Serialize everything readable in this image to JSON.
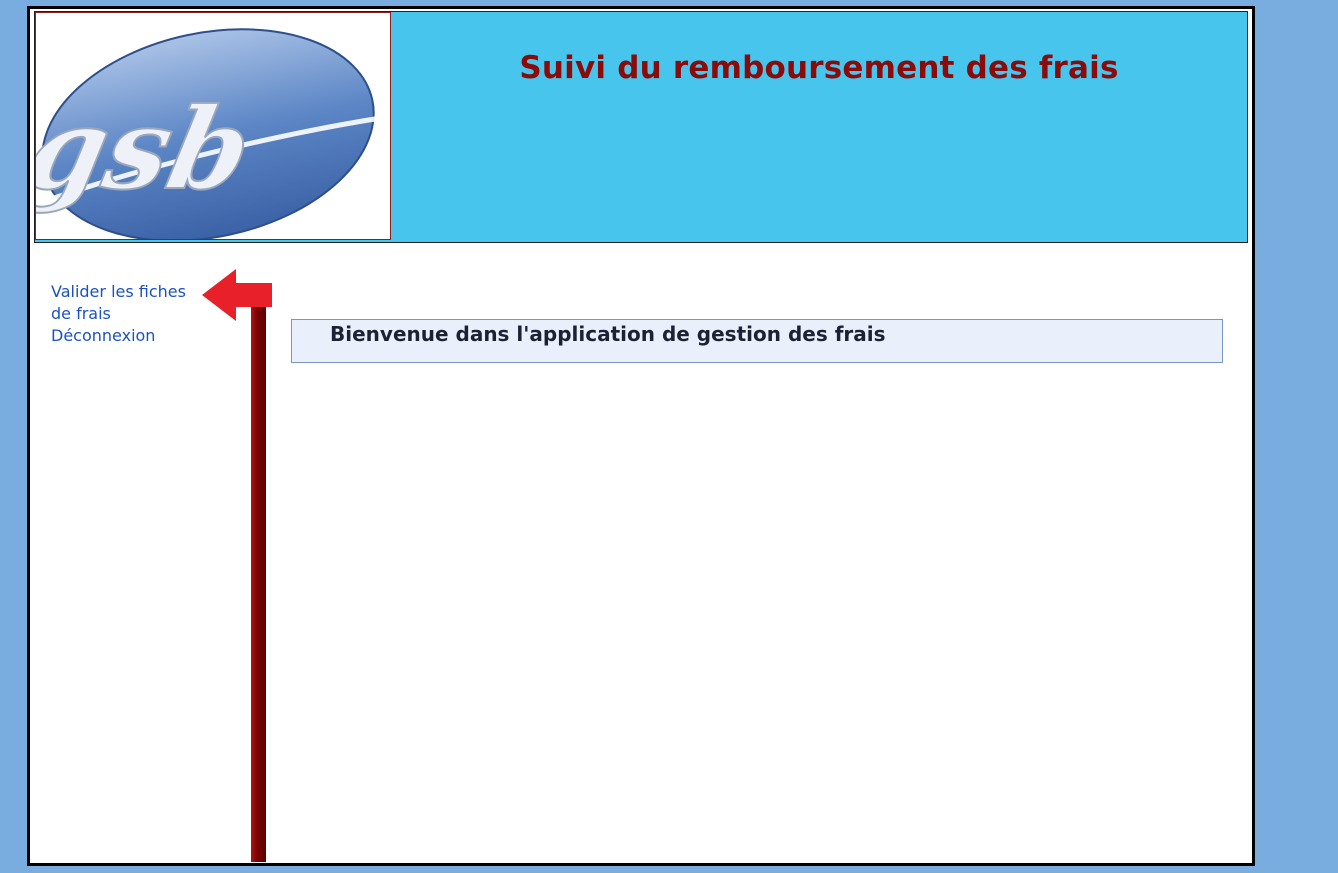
{
  "header": {
    "logo_text": "gsb",
    "title": "Suivi du remboursement des frais"
  },
  "nav": {
    "items": [
      {
        "label": "Valider les fiches de frais"
      },
      {
        "label": "Déconnexion"
      }
    ]
  },
  "main": {
    "welcome": "Bienvenue dans l'application de gestion des frais"
  },
  "colors": {
    "page_background": "#7aaddf",
    "header_background": "#48c5ec",
    "title_color": "#8b0b0b",
    "link_color": "#1a52c4",
    "arrow_color": "#e8202a",
    "divider_color": "#7a0000",
    "welcome_background": "#e9f0fb"
  }
}
